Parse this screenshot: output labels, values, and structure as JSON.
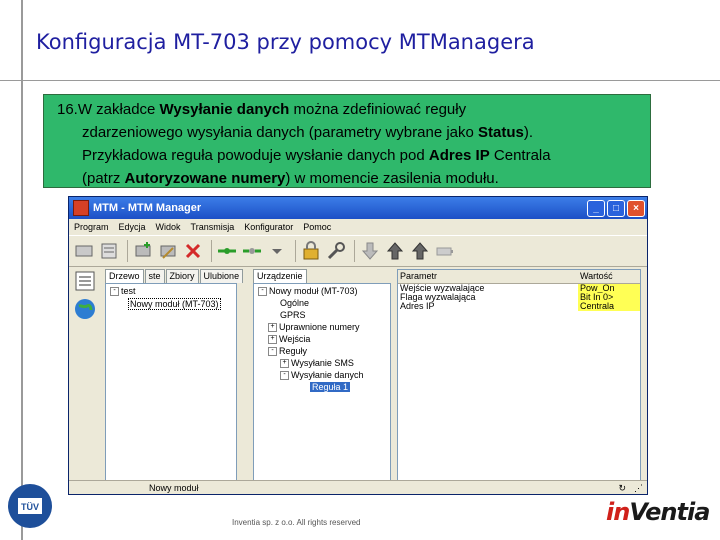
{
  "slide": {
    "title": "Konfiguracja MT-703 przy pomocy MTManagera",
    "note": {
      "line1_pre": "16.W zakładce ",
      "line1_bold": "Wysyłanie danych",
      "line1_post": " można zdefiniować reguły",
      "line2_pre": "zdarzeniowego wysyłania danych (parametry wybrane jako ",
      "line2_bold": "Status",
      "line2_post": ").",
      "line3_pre": "Przykładowa reguła powoduje wysłanie danych pod ",
      "line3_bold": "Adres IP",
      "line3_post": " Centrala",
      "line4_pre": "(patrz ",
      "line4_bold": "Autoryzowane numery",
      "line4_post": ") w momencie zasilenia modułu."
    },
    "footer": "Inventia sp. z o.o. All rights reserved",
    "logo_red": "in",
    "logo_black": "Ventia"
  },
  "window": {
    "title": "MTM - MTM Manager",
    "menu": [
      "Program",
      "Edycja",
      "Widok",
      "Transmisja",
      "Konfigurator",
      "Pomoc"
    ],
    "tabs_left": [
      "Drzewo",
      "ste",
      "Zbiory",
      "Ulubione"
    ],
    "tab_device": "Urządzenie",
    "tree_left": {
      "root": "test",
      "child": "Nowy moduł (MT-703)"
    },
    "tree_device": {
      "root": "Nowy moduł (MT-703)",
      "items": [
        "Ogólne",
        "GPRS",
        "Uprawnione numery",
        "Wejścia",
        "Reguły",
        "Wysyłanie SMS",
        "Wysyłanie danych",
        "Reguła 1"
      ]
    },
    "grid": {
      "header_param": "Parametr",
      "header_value": "Wartość",
      "rows": [
        {
          "param": "Wejście wyzwalające",
          "value": "Pow_On"
        },
        {
          "param": "Flaga wyzwalająca",
          "value": "Bit In 0>"
        },
        {
          "param": "Adres IP",
          "value": "Centrala"
        }
      ]
    },
    "status": "Nowy moduł"
  },
  "colors": {
    "title": "#1f1fa0",
    "note_bg": "#2fb86b",
    "value_bg": "#ffff55"
  }
}
